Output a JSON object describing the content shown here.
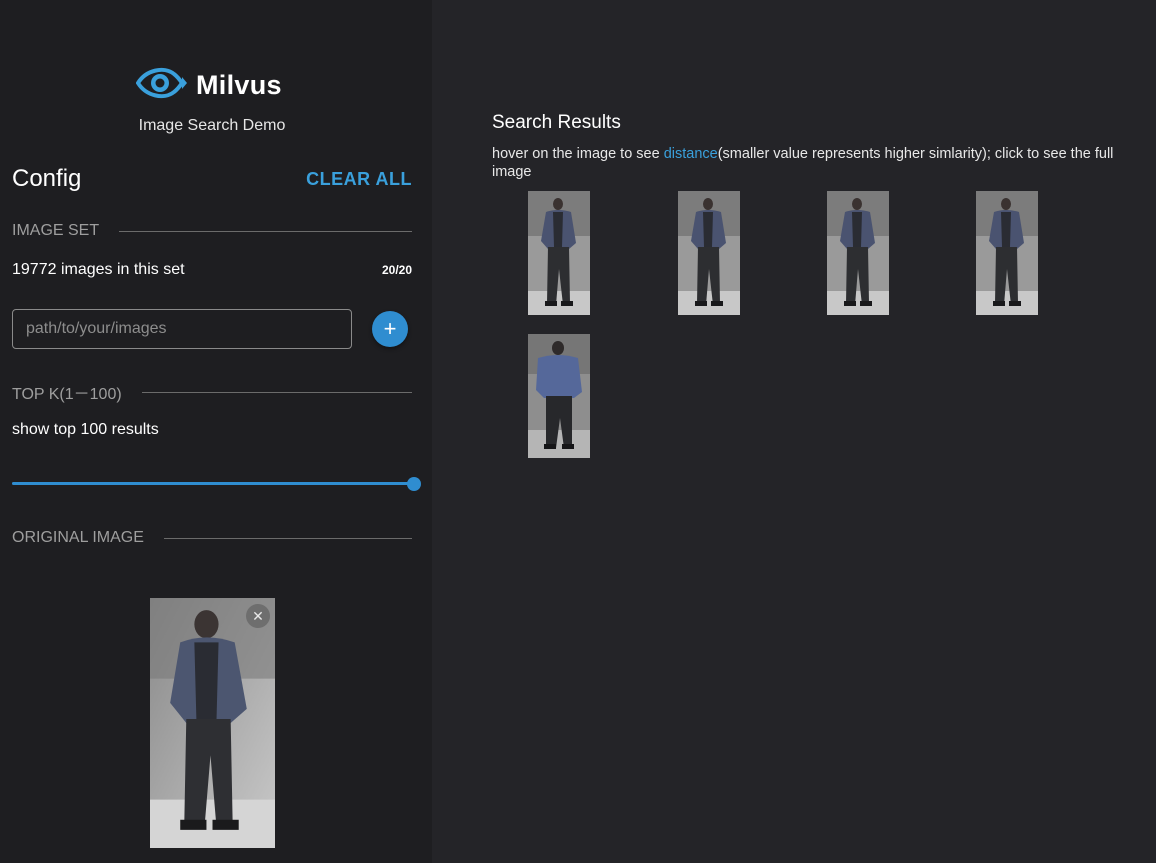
{
  "brand": {
    "name": "Milvus",
    "subtitle": "Image Search Demo",
    "icon": "eye-logo-icon",
    "accent_color": "#3aa0dc"
  },
  "config": {
    "title": "Config",
    "clear_all_label": "CLEAR ALL",
    "image_set": {
      "section_label": "IMAGE SET",
      "info": "19772 images in this set",
      "count": "20/20",
      "path_placeholder": "path/to/your/images",
      "path_value": "",
      "add_icon": "plus-icon",
      "add_label": "+"
    },
    "top_k": {
      "section_label": "TOP K(1－100)",
      "info": "show top 100 results",
      "slider_value": 100,
      "slider_min": 1,
      "slider_max": 100
    },
    "original_image": {
      "section_label": "ORIGINAL IMAGE",
      "close_icon": "close-icon",
      "close_label": "✕"
    }
  },
  "results": {
    "title": "Search Results",
    "hint_before": "hover on the image to see ",
    "hint_link": "distance",
    "hint_after": "(smaller value represents higher simlarity); click to see the full image",
    "thumbnails": [
      {
        "variant": "walking"
      },
      {
        "variant": "walking"
      },
      {
        "variant": "walking"
      },
      {
        "variant": "walking"
      },
      {
        "variant": "back"
      }
    ]
  }
}
